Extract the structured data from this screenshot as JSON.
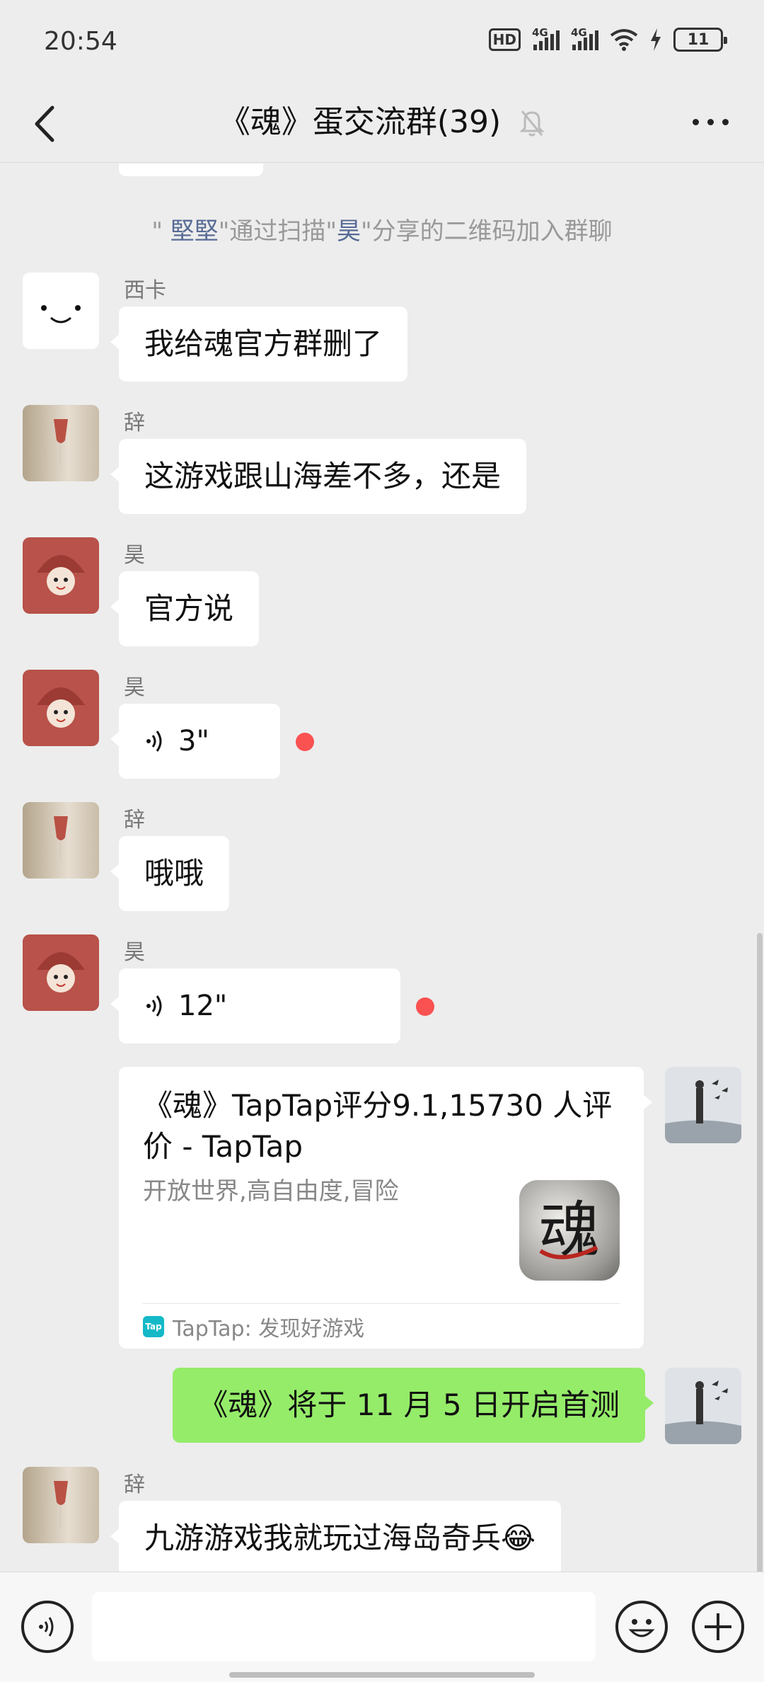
{
  "status_bar": {
    "time": "20:54",
    "hd_label": "HD",
    "network_1": "4G",
    "network_2": "4G",
    "battery_level": "11"
  },
  "header": {
    "title": "《魂》蛋交流群(39)",
    "icons": [
      "back-arrow-icon",
      "mute-bell-icon",
      "more-dots-icon"
    ]
  },
  "chat": {
    "system_notice": {
      "quote_open": "\" ",
      "user1": "堅堅",
      "middle": "\"通过扫描\"",
      "user2": "昊",
      "end": "\"分享的二维码加入群聊"
    },
    "messages": [
      {
        "sender": "西卡",
        "text": "我给魂官方群删了"
      },
      {
        "sender": "辞",
        "text": "这游戏跟山海差不多，还是"
      },
      {
        "sender": "昊",
        "text": "官方说"
      },
      {
        "sender": "昊",
        "voice_duration": "3\""
      },
      {
        "sender": "辞",
        "text": "哦哦"
      },
      {
        "sender": "昊",
        "voice_duration": "12\""
      },
      {
        "sender": "me",
        "link_card": {
          "title": "《魂》TapTap评分9.1,15730 人评价 - TapTap",
          "description": "开放世界,高自由度,冒险",
          "thumb_char": "魂",
          "logo_text": "Tap",
          "source": "TapTap: 发现好游戏"
        }
      },
      {
        "sender": "me",
        "text": "《魂》将于 11 月 5 日开启首测"
      },
      {
        "sender": "辞",
        "text": "九游游戏我就玩过海岛奇兵😂"
      }
    ]
  },
  "input_bar": {
    "icons": [
      "voice-input-icon",
      "emoji-icon",
      "plus-icon"
    ]
  },
  "colors": {
    "background": "#ededed",
    "sent_bubble": "#95ec69",
    "link_name": "#576b95",
    "unread_dot": "#fa5151"
  }
}
